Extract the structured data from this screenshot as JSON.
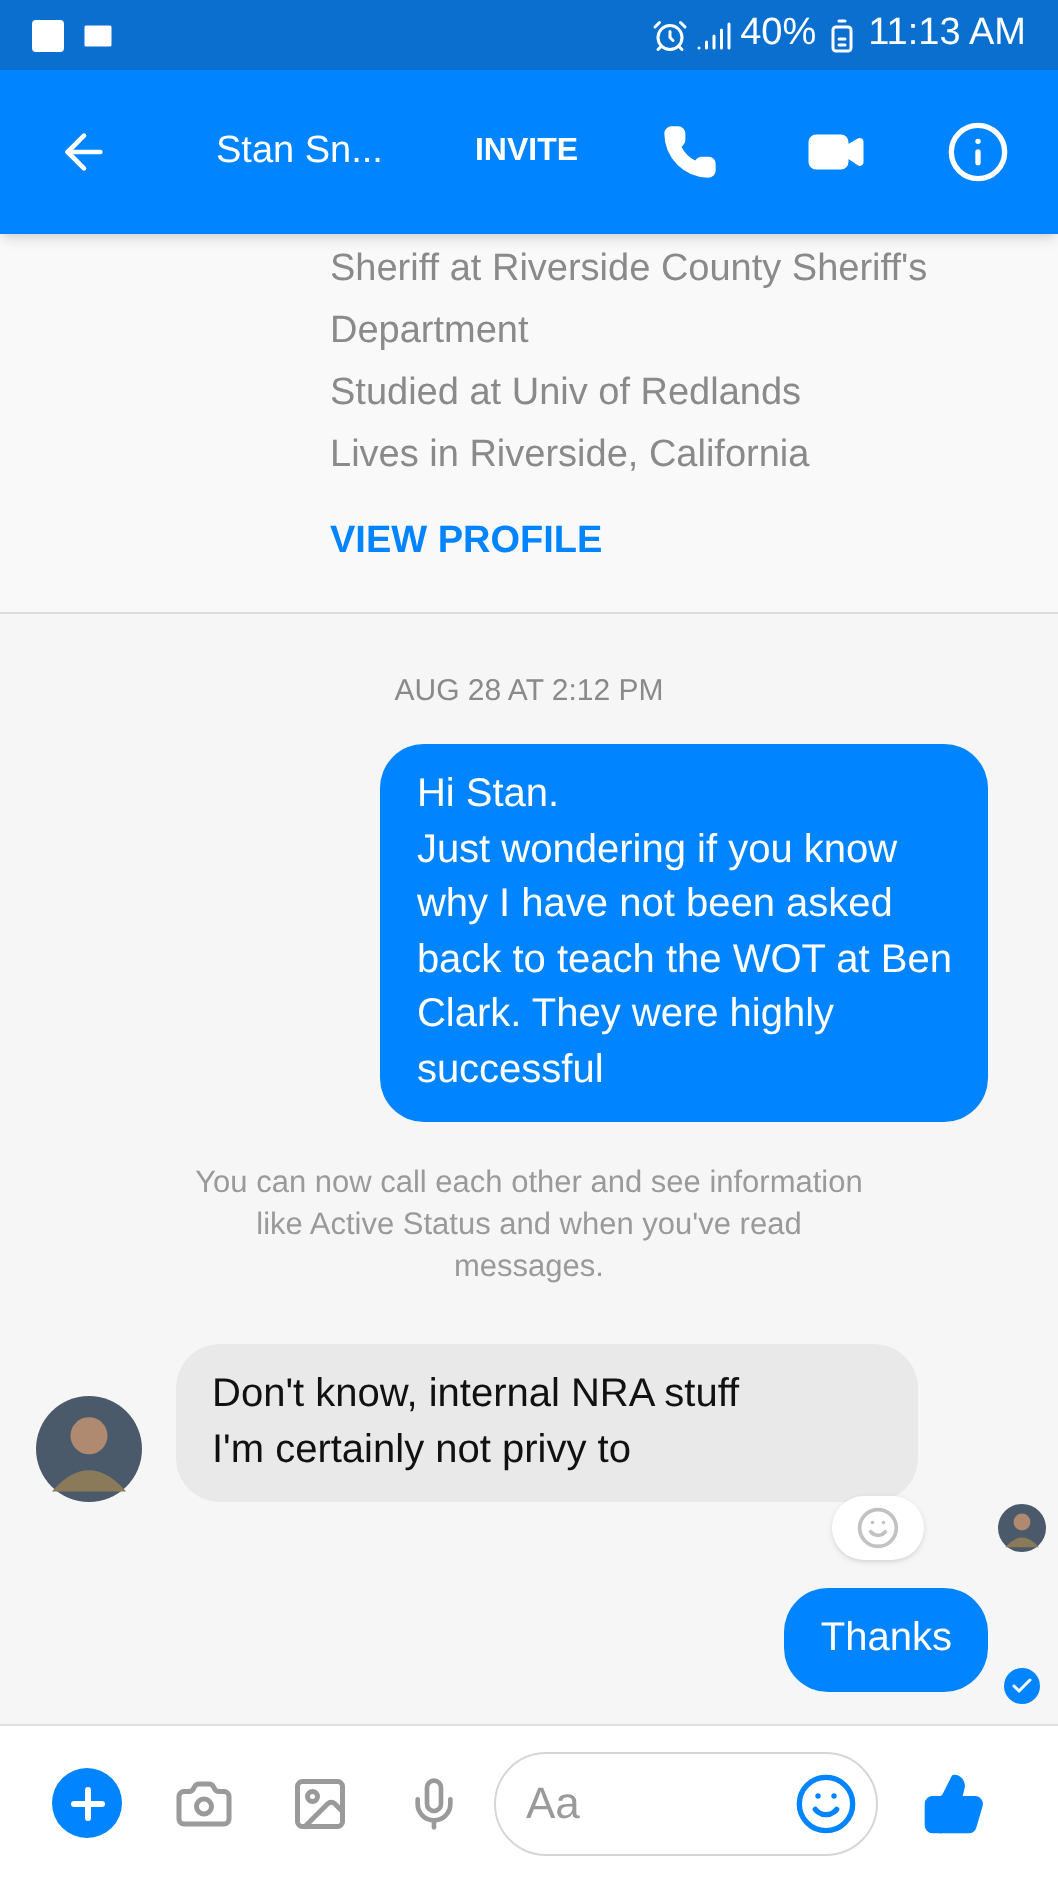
{
  "status_bar": {
    "battery": "40%",
    "time": "11:13 AM"
  },
  "header": {
    "title": "Stan Sn...",
    "invite": "INVITE"
  },
  "profile": {
    "lines": [
      "Sheriff at Riverside County Sheriff's",
      "Department",
      "Studied at Univ of Redlands",
      "Lives in Riverside, California"
    ],
    "link": "VIEW PROFILE"
  },
  "timestamp": "AUG 28 AT 2:12 PM",
  "messages": [
    {
      "kind": "outgoing",
      "text": "Hi Stan.\nJust wondering if you know\nwhy I have not been asked\nback to teach the WOT at Ben\nClark. They were highly\nsuccessful"
    },
    {
      "kind": "notice",
      "text": "You can now call each other and see information like Active Status and when you've read messages."
    },
    {
      "kind": "incoming",
      "text": "Don't know, internal NRA stuff\nI'm certainly not privy to"
    },
    {
      "kind": "outgoing",
      "text": "Thanks",
      "delivered": true
    }
  ],
  "composer": {
    "placeholder": "Aa"
  }
}
